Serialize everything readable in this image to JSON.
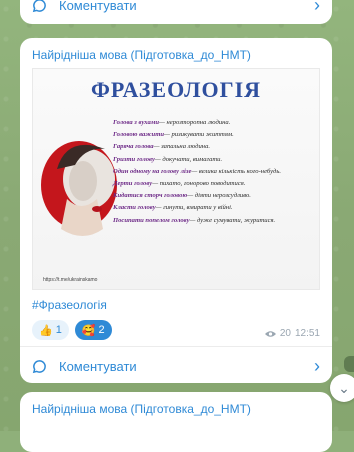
{
  "top_card": {
    "comment_label": "Коментувати"
  },
  "post": {
    "channel": "Найрідніша мова (Підготовка_до_НМТ)",
    "image": {
      "title": "ФРАЗЕОЛОГІЯ",
      "lines": [
        {
          "phrase": "Голова з вухами",
          "meaning": "— нерозторопна людина."
        },
        {
          "phrase": "Головою важити",
          "meaning": "— ризикувати життям."
        },
        {
          "phrase": "Гаряча голова",
          "meaning": "— запальна людина."
        },
        {
          "phrase": "Гризти голову",
          "meaning": "— докучати, вимагати."
        },
        {
          "phrase": "Один одному на голову лізе",
          "meaning": "— велика кількість кого-небудь."
        },
        {
          "phrase": "Дерти голову",
          "meaning": "— пихато, гонорово поводитися."
        },
        {
          "phrase": "Кидатися сторч головою",
          "meaning": "— діяти нерозсудливо."
        },
        {
          "phrase": "Класти голову",
          "meaning": "— гинути, вмирати у війні."
        },
        {
          "phrase": "Посипати попелом голову",
          "meaning": "— дуже сумувати, журитися."
        }
      ],
      "url": "https://t.me/ukrainskamo"
    },
    "hashtag": "#Фразеологія",
    "reactions": [
      {
        "emoji": "👍",
        "count": "1"
      },
      {
        "emoji": "🥰",
        "count": "2"
      }
    ],
    "views": "20",
    "time": "12:51",
    "comment_label": "Коментувати"
  },
  "next_post": {
    "channel": "Найрідніша мова (Підготовка_до_НМТ)"
  }
}
